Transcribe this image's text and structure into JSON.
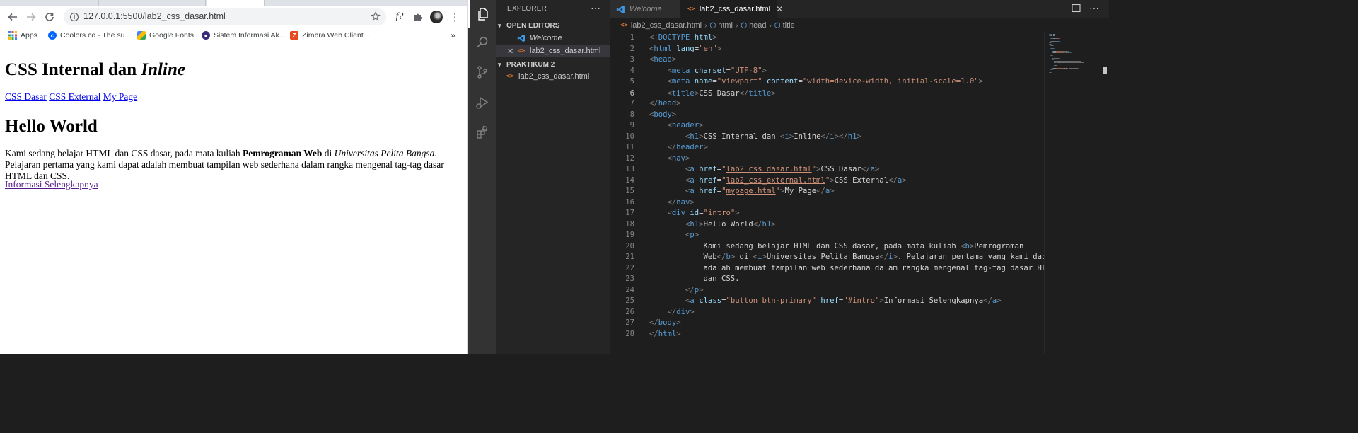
{
  "browser": {
    "url": "127.0.0.1:5500/lab2_css_dasar.html",
    "bookmarks": [
      {
        "label": "Apps"
      },
      {
        "label": "Coolors.co - The su..."
      },
      {
        "label": "Google Fonts"
      },
      {
        "label": "Sistem Informasi Ak..."
      },
      {
        "label": "Zimbra Web Client..."
      }
    ],
    "bookmarks_more": "»",
    "page": {
      "h1_prefix": "CSS Internal dan ",
      "h1_italic": "Inline",
      "nav_links": [
        "CSS Dasar",
        "CSS External",
        "My Page"
      ],
      "h1_intro": "Hello World",
      "p_part1": "Kami sedang belajar HTML dan CSS dasar, pada mata kuliah ",
      "p_bold": "Pemrograman Web",
      "p_part2": " di ",
      "p_italic": "Universitas Pelita Bangsa",
      "p_part3": ". Pelajaran pertama yang kami dapat adalah membuat tampilan web sederhana dalam rangka mengenal tag-tag dasar HTML dan CSS.",
      "more_link": "Informasi Selengkapnya"
    }
  },
  "vscode": {
    "explorer_title": "EXPLORER",
    "more_actions": "···",
    "open_editors_label": "OPEN EDITORS",
    "open_editors": [
      {
        "name": "Welcome"
      },
      {
        "name": "lab2_css_dasar.html"
      }
    ],
    "folder_label": "PRAKTIKUM 2",
    "folder_files": [
      {
        "name": "lab2_css_dasar.html"
      }
    ],
    "tabs": [
      {
        "name": "Welcome"
      },
      {
        "name": "lab2_css_dasar.html"
      }
    ],
    "breadcrumb": [
      "lab2_css_dasar.html",
      "html",
      "head",
      "title"
    ],
    "current_line": 6,
    "lines": [
      [
        [
          "pu",
          "<!"
        ],
        [
          "tg",
          "DOCTYPE "
        ],
        [
          "at",
          "html"
        ],
        [
          "pu",
          ">"
        ]
      ],
      [
        [
          "pu",
          "<"
        ],
        [
          "tg",
          "html "
        ],
        [
          "at",
          "lang"
        ],
        [
          "tx",
          "="
        ],
        [
          "st",
          "\"en\""
        ],
        [
          "pu",
          ">"
        ]
      ],
      [
        [
          "pu",
          "<"
        ],
        [
          "tg",
          "head"
        ],
        [
          "pu",
          ">"
        ]
      ],
      [
        [
          "tx",
          "    "
        ],
        [
          "pu",
          "<"
        ],
        [
          "tg",
          "meta "
        ],
        [
          "at",
          "charset"
        ],
        [
          "tx",
          "="
        ],
        [
          "st",
          "\"UTF-8\""
        ],
        [
          "pu",
          ">"
        ]
      ],
      [
        [
          "tx",
          "    "
        ],
        [
          "pu",
          "<"
        ],
        [
          "tg",
          "meta "
        ],
        [
          "at",
          "name"
        ],
        [
          "tx",
          "="
        ],
        [
          "st",
          "\"viewport\" "
        ],
        [
          "at",
          "content"
        ],
        [
          "tx",
          "="
        ],
        [
          "st",
          "\"width=device-width, initial-scale=1.0\""
        ],
        [
          "pu",
          ">"
        ]
      ],
      [
        [
          "tx",
          "    "
        ],
        [
          "pu",
          "<"
        ],
        [
          "tg",
          "title"
        ],
        [
          "pu",
          ">"
        ],
        [
          "tx",
          "CSS Dasar"
        ],
        [
          "pu",
          "</"
        ],
        [
          "tg",
          "title"
        ],
        [
          "pu",
          ">"
        ]
      ],
      [
        [
          "pu",
          "</"
        ],
        [
          "tg",
          "head"
        ],
        [
          "pu",
          ">"
        ]
      ],
      [
        [
          "pu",
          "<"
        ],
        [
          "tg",
          "body"
        ],
        [
          "pu",
          ">"
        ]
      ],
      [
        [
          "tx",
          "    "
        ],
        [
          "pu",
          "<"
        ],
        [
          "tg",
          "header"
        ],
        [
          "pu",
          ">"
        ]
      ],
      [
        [
          "tx",
          "        "
        ],
        [
          "pu",
          "<"
        ],
        [
          "tg",
          "h1"
        ],
        [
          "pu",
          ">"
        ],
        [
          "tx",
          "CSS Internal dan "
        ],
        [
          "pu",
          "<"
        ],
        [
          "tg",
          "i"
        ],
        [
          "pu",
          ">"
        ],
        [
          "tx",
          "Inline"
        ],
        [
          "pu",
          "</"
        ],
        [
          "tg",
          "i"
        ],
        [
          "pu",
          "></"
        ],
        [
          "tg",
          "h1"
        ],
        [
          "pu",
          ">"
        ]
      ],
      [
        [
          "tx",
          "    "
        ],
        [
          "pu",
          "</"
        ],
        [
          "tg",
          "header"
        ],
        [
          "pu",
          ">"
        ]
      ],
      [
        [
          "tx",
          "    "
        ],
        [
          "pu",
          "<"
        ],
        [
          "tg",
          "nav"
        ],
        [
          "pu",
          ">"
        ]
      ],
      [
        [
          "tx",
          "        "
        ],
        [
          "pu",
          "<"
        ],
        [
          "tg",
          "a "
        ],
        [
          "at",
          "href"
        ],
        [
          "tx",
          "="
        ],
        [
          "st",
          "\""
        ],
        [
          "su",
          "lab2_css_dasar.html"
        ],
        [
          "st",
          "\""
        ],
        [
          "pu",
          ">"
        ],
        [
          "tx",
          "CSS Dasar"
        ],
        [
          "pu",
          "</"
        ],
        [
          "tg",
          "a"
        ],
        [
          "pu",
          ">"
        ]
      ],
      [
        [
          "tx",
          "        "
        ],
        [
          "pu",
          "<"
        ],
        [
          "tg",
          "a "
        ],
        [
          "at",
          "href"
        ],
        [
          "tx",
          "="
        ],
        [
          "st",
          "\""
        ],
        [
          "su",
          "lab2_css_external.html"
        ],
        [
          "st",
          "\""
        ],
        [
          "pu",
          ">"
        ],
        [
          "tx",
          "CSS External"
        ],
        [
          "pu",
          "</"
        ],
        [
          "tg",
          "a"
        ],
        [
          "pu",
          ">"
        ]
      ],
      [
        [
          "tx",
          "        "
        ],
        [
          "pu",
          "<"
        ],
        [
          "tg",
          "a "
        ],
        [
          "at",
          "href"
        ],
        [
          "tx",
          "="
        ],
        [
          "st",
          "\""
        ],
        [
          "su",
          "mypage.html"
        ],
        [
          "st",
          "\""
        ],
        [
          "pu",
          ">"
        ],
        [
          "tx",
          "My Page"
        ],
        [
          "pu",
          "</"
        ],
        [
          "tg",
          "a"
        ],
        [
          "pu",
          ">"
        ]
      ],
      [
        [
          "tx",
          "    "
        ],
        [
          "pu",
          "</"
        ],
        [
          "tg",
          "nav"
        ],
        [
          "pu",
          ">"
        ]
      ],
      [
        [
          "tx",
          "    "
        ],
        [
          "pu",
          "<"
        ],
        [
          "tg",
          "div "
        ],
        [
          "at",
          "id"
        ],
        [
          "tx",
          "="
        ],
        [
          "st",
          "\"intro\""
        ],
        [
          "pu",
          ">"
        ]
      ],
      [
        [
          "tx",
          "        "
        ],
        [
          "pu",
          "<"
        ],
        [
          "tg",
          "h1"
        ],
        [
          "pu",
          ">"
        ],
        [
          "tx",
          "Hello World"
        ],
        [
          "pu",
          "</"
        ],
        [
          "tg",
          "h1"
        ],
        [
          "pu",
          ">"
        ]
      ],
      [
        [
          "tx",
          "        "
        ],
        [
          "pu",
          "<"
        ],
        [
          "tg",
          "p"
        ],
        [
          "pu",
          ">"
        ]
      ],
      [
        [
          "tx",
          "            Kami sedang belajar HTML dan CSS dasar, pada mata kuliah "
        ],
        [
          "pu",
          "<"
        ],
        [
          "tg",
          "b"
        ],
        [
          "pu",
          ">"
        ],
        [
          "tx",
          "Pemrograman"
        ]
      ],
      [
        [
          "tx",
          "            Web"
        ],
        [
          "pu",
          "</"
        ],
        [
          "tg",
          "b"
        ],
        [
          "pu",
          ">"
        ],
        [
          "tx",
          " di "
        ],
        [
          "pu",
          "<"
        ],
        [
          "tg",
          "i"
        ],
        [
          "pu",
          ">"
        ],
        [
          "tx",
          "Universitas Pelita Bangsa"
        ],
        [
          "pu",
          "</"
        ],
        [
          "tg",
          "i"
        ],
        [
          "pu",
          ">"
        ],
        [
          "tx",
          ". Pelajaran pertama yang kami dapa"
        ]
      ],
      [
        [
          "tx",
          "            adalah membuat tampilan web sederhana dalam rangka mengenal tag-tag dasar HTM"
        ]
      ],
      [
        [
          "tx",
          "            dan CSS."
        ]
      ],
      [
        [
          "tx",
          "        "
        ],
        [
          "pu",
          "</"
        ],
        [
          "tg",
          "p"
        ],
        [
          "pu",
          ">"
        ]
      ],
      [
        [
          "tx",
          "        "
        ],
        [
          "pu",
          "<"
        ],
        [
          "tg",
          "a "
        ],
        [
          "at",
          "class"
        ],
        [
          "tx",
          "="
        ],
        [
          "st",
          "\"button btn-primary\" "
        ],
        [
          "at",
          "href"
        ],
        [
          "tx",
          "="
        ],
        [
          "st",
          "\""
        ],
        [
          "su",
          "#intro"
        ],
        [
          "st",
          "\""
        ],
        [
          "pu",
          ">"
        ],
        [
          "tx",
          "Informasi Selengkapnya"
        ],
        [
          "pu",
          "</"
        ],
        [
          "tg",
          "a"
        ],
        [
          "pu",
          ">"
        ]
      ],
      [
        [
          "tx",
          "    "
        ],
        [
          "pu",
          "</"
        ],
        [
          "tg",
          "div"
        ],
        [
          "pu",
          ">"
        ]
      ],
      [
        [
          "pu",
          "</"
        ],
        [
          "tg",
          "body"
        ],
        [
          "pu",
          ">"
        ]
      ],
      [
        [
          "pu",
          "</"
        ],
        [
          "tg",
          "html"
        ],
        [
          "pu",
          ">"
        ]
      ]
    ],
    "colors": {
      "activity_bar": "#333333",
      "sidebar": "#252526",
      "editor": "#1e1e1e",
      "tag": "#569cd6",
      "attribute": "#9cdcfe",
      "string": "#ce9178",
      "html_icon": "#e37933",
      "vscode_icon": "#3b99e8"
    },
    "icons": [
      "files-icon",
      "search-icon",
      "source-control-icon",
      "run-debug-icon",
      "extensions-icon"
    ]
  }
}
